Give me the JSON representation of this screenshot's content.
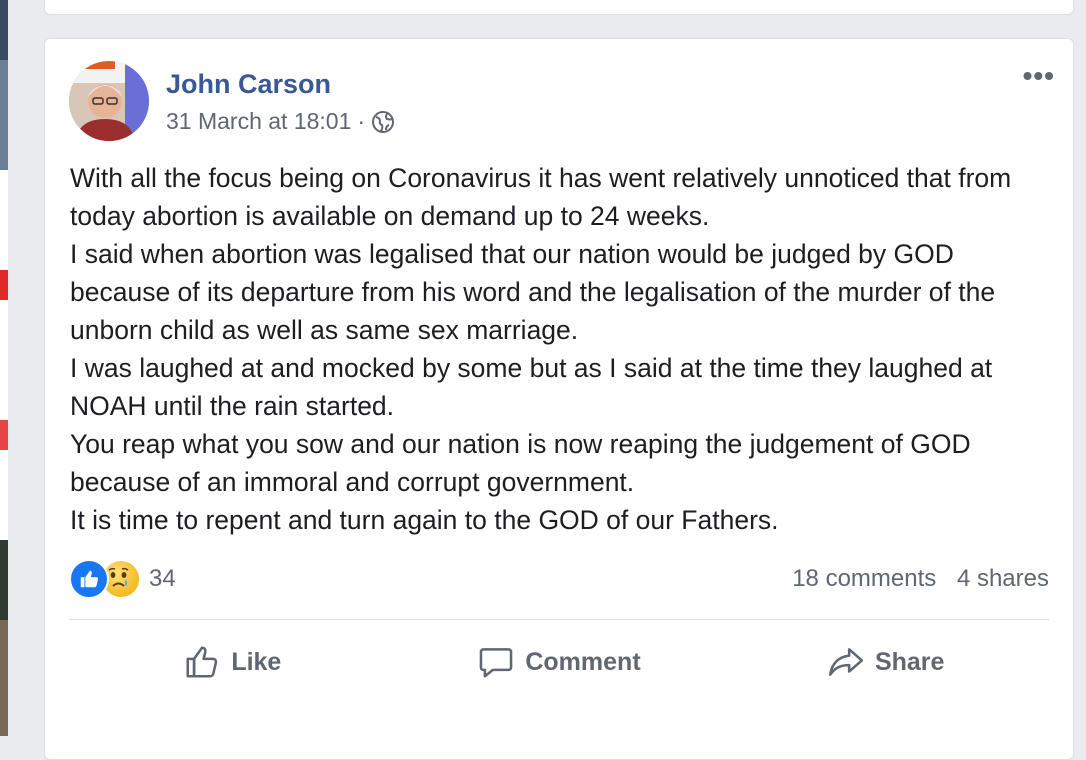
{
  "post": {
    "author": "John Carson",
    "timestamp": "31 March at 18:01",
    "separator": "·",
    "privacy_icon": "globe-icon",
    "more_icon": "more-options-icon",
    "text": [
      "With all the focus being on Coronavirus it has went relatively unnoticed that from today abortion is available on demand up to 24 weeks.",
      "I said when abortion was legalised that our nation would be judged by GOD because of its departure from his word and the legalisation of the murder of the unborn child as well as same sex marriage.",
      "I was laughed at and mocked by some but as I said at the time they laughed at NOAH until the rain started.",
      "You reap what you sow and our nation is now reaping the judgement of GOD because of an immoral and corrupt government.",
      "It is time to repent and turn again to the GOD of our Fathers."
    ],
    "reactions": {
      "icons": [
        "like-reaction-icon",
        "sad-reaction-icon"
      ],
      "count": "34"
    },
    "comments": "18 comments",
    "shares": "4 shares"
  },
  "actions": {
    "like_label": "Like",
    "comment_label": "Comment",
    "share_label": "Share"
  },
  "colors": {
    "author": "#385898",
    "meta": "#606770",
    "like_blue": "#1877f2",
    "background": "#e9ebee"
  }
}
